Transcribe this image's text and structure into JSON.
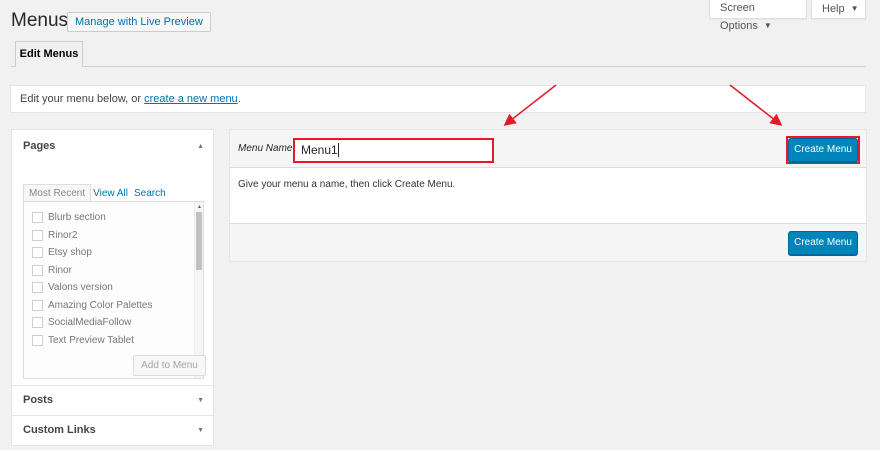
{
  "header": {
    "title": "Menus",
    "live_preview_label": "Manage with Live Preview",
    "screen_options_label": "Screen Options",
    "help_label": "Help"
  },
  "nav": {
    "active_tab": "Edit Menus"
  },
  "notice": {
    "text_before": "Edit your menu below, or ",
    "link_text": "create a new menu",
    "text_after": "."
  },
  "sidebar": {
    "pages": {
      "title": "Pages",
      "tabs": [
        "Most Recent",
        "View All",
        "Search"
      ],
      "items": [
        "Blurb section",
        "Rinor2",
        "Etsy shop",
        "Rinor",
        "Valons version",
        "Amazing Color Palettes",
        "SocialMediaFollow",
        "Text Preview Tablet"
      ],
      "add_button": "Add to Menu"
    },
    "posts_title": "Posts",
    "custom_links_title": "Custom Links"
  },
  "menu_editor": {
    "name_label": "Menu Name",
    "name_value": "Menu1",
    "create_button": "Create Menu",
    "instructions": "Give your menu a name, then click Create Menu."
  },
  "colors": {
    "primary_button": "#0085ba",
    "highlight": "#e21a2a",
    "link": "#0073aa"
  }
}
